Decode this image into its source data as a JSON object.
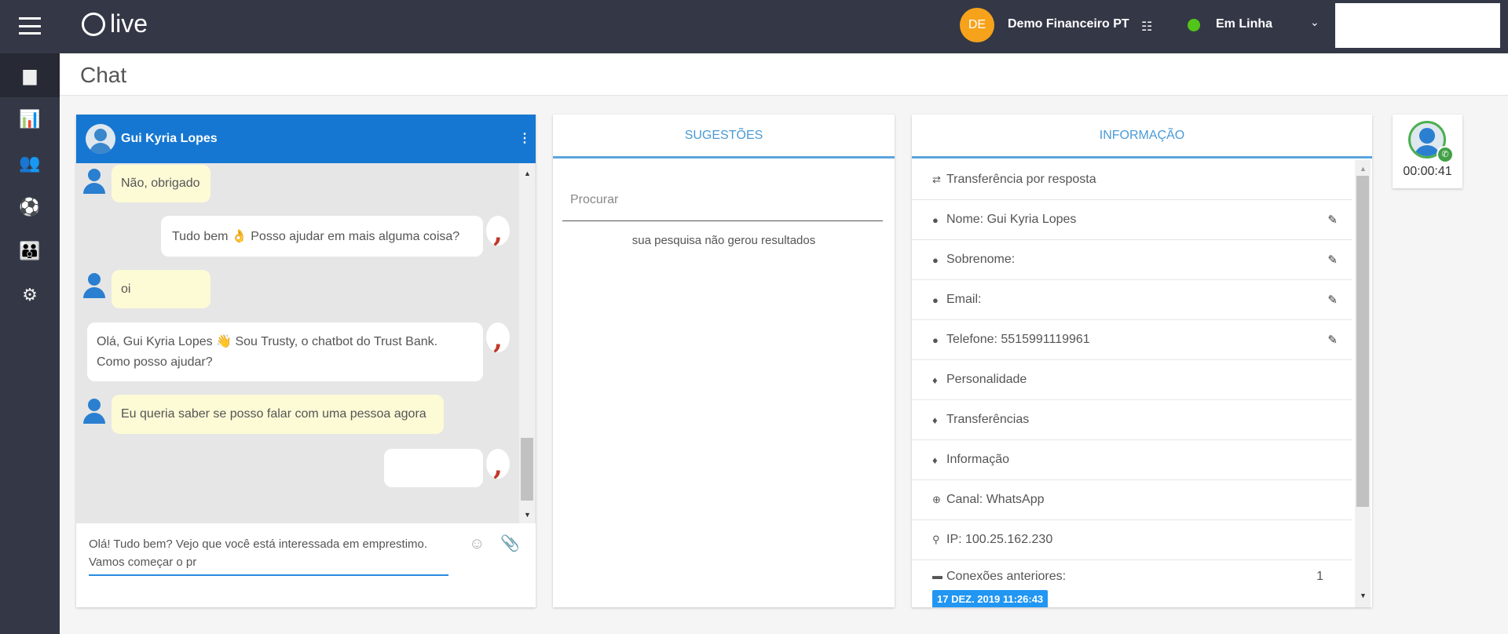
{
  "topbar": {
    "logo": "live",
    "avatar_initials": "DE",
    "account": "Demo Financeiro PT",
    "status": "Em Linha",
    "status_color": "#52c41a",
    "avatar_color": "#f7a21b"
  },
  "page_title": "Chat",
  "chat": {
    "contact": "Gui Kyria Lopes",
    "messages": [
      {
        "from": "user",
        "text": "Não, obrigado"
      },
      {
        "from": "bot",
        "text": "Tudo bem 👌  Posso ajudar em mais alguma coisa?"
      },
      {
        "from": "user",
        "text": "oi"
      },
      {
        "from": "bot",
        "text": "Olá, Gui Kyria Lopes 👋 Sou Trusty, o chatbot do Trust Bank. Como posso ajudar?"
      },
      {
        "from": "user",
        "text": "Eu queria saber se posso falar com uma pessoa agora"
      },
      {
        "from": "bot",
        "text": ""
      }
    ],
    "input_value": "Olá! Tudo bem? Vejo que você está interessada em emprestimo. Vamos começar o pr"
  },
  "suggestions": {
    "title": "SUGESTÕES",
    "search_placeholder": "Procurar",
    "empty": "sua pesquisa não gerou resultados"
  },
  "info": {
    "title": "INFORMAÇÃO",
    "rows": [
      {
        "icon": "transfer-icon",
        "label": "Transferência por resposta"
      },
      {
        "icon": "user-icon",
        "label": "Nome: Gui Kyria Lopes",
        "editable": true
      },
      {
        "icon": "user-icon",
        "label": "Sobrenome:",
        "editable": true
      },
      {
        "icon": "user-icon",
        "label": "Email:",
        "editable": true
      },
      {
        "icon": "user-icon",
        "label": "Telefone: 5515991119961",
        "editable": true
      },
      {
        "icon": "bell-icon",
        "label": "Personalidade"
      },
      {
        "icon": "bell-icon",
        "label": "Transferências"
      },
      {
        "icon": "bell-icon",
        "label": "Informação"
      },
      {
        "icon": "globe-icon",
        "label": "Canal: WhatsApp"
      },
      {
        "icon": "pin-icon",
        "label": "IP: 100.25.162.230"
      },
      {
        "icon": "chat-icon",
        "label": "Conexões anteriores:",
        "count": "1",
        "badge": "17 DEZ. 2019 11:26:43"
      }
    ]
  },
  "queue": {
    "timer": "00:00:41"
  }
}
